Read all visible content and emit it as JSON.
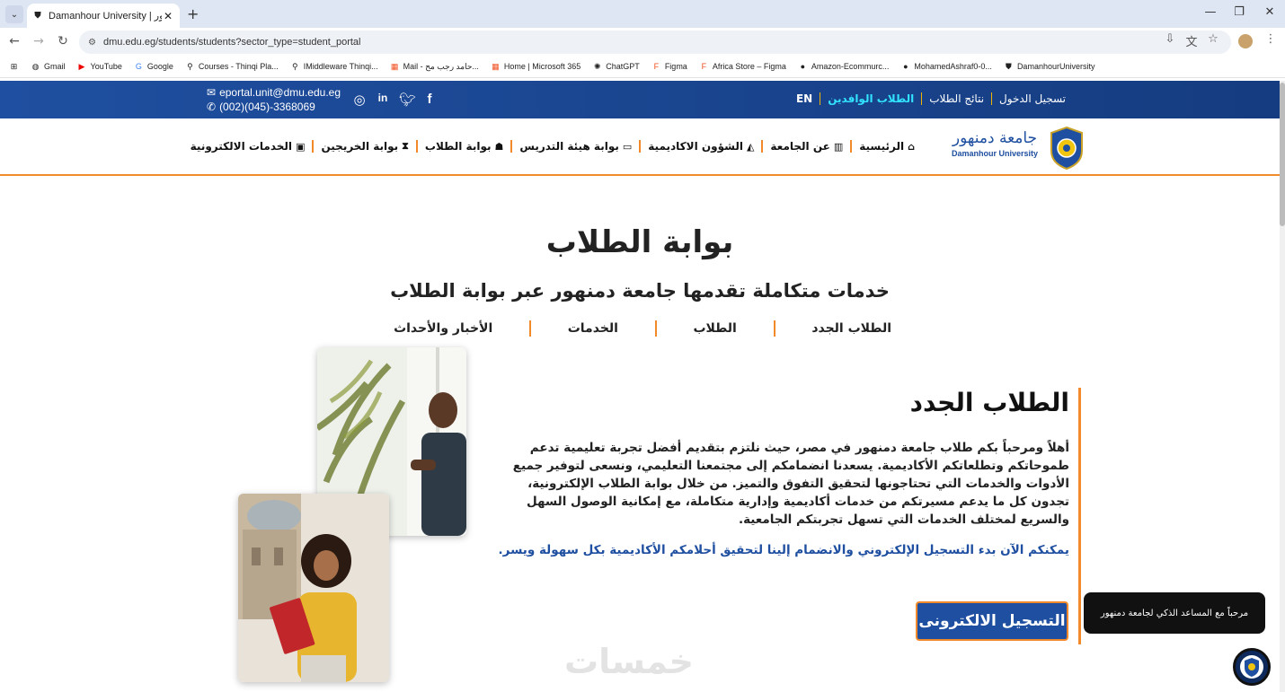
{
  "browser": {
    "tab_title": "Damanhour University | جامعة دمنهور",
    "url": "dmu.edu.eg/students/students?sector_type=student_portal",
    "bookmarks": [
      "Gmail",
      "YouTube",
      "Google",
      "Courses - Thinqi Pla...",
      "IMiddleware Thinqi...",
      "Mail - حامد رجب مح...",
      "Home | Microsoft 365",
      "ChatGPT",
      "Figma",
      "Africa Store – Figma",
      "Amazon-Ecommurc...",
      "MohamedAshraf0-0...",
      "DamanhourUniversity"
    ]
  },
  "topbar": {
    "email": "eportal.unit@dmu.edu.eg",
    "phone": "(002)(045)-3368069",
    "links": [
      "تسجيل الدخول",
      "نتائج الطلاب",
      "الطلاب الوافدين",
      "EN"
    ]
  },
  "logo": {
    "arabic": "جامعة دمنهور",
    "english": "Damanhour University"
  },
  "menu": [
    "الرئيسية",
    "عن الجامعة",
    "الشؤون الاكاديمية",
    "بوابة هيئة التدريس",
    "بوابة الطلاب",
    "بوابة الخريجين",
    "الخدمات الالكترونية"
  ],
  "hero": {
    "title": "بوابة الطلاب",
    "subtitle": "خدمات متكاملة تقدمها جامعة دمنهور عبر بوابة الطلاب",
    "tabs": [
      "الطلاب الجدد",
      "الطلاب",
      "الخدمات",
      "الأخبار والأحداث"
    ]
  },
  "section": {
    "heading": "الطلاب الجدد",
    "body": "أهلاً ومرحباً بكم طلاب جامعة دمنهور في مصر، حيث نلتزم بتقديم أفضل تجربة تعليمية تدعم طموحاتكم وتطلعاتكم الأكاديمية. يسعدنا انضمامكم إلى مجتمعنا التعليمي، ونسعى لتوفير جميع الأدوات والخدمات التي تحتاجونها لتحقيق التفوق والتميز. من خلال بوابة الطلاب الإلكترونية، تجدون كل ما يدعم مسيرتكم من خدمات أكاديمية وإدارية متكاملة، مع إمكانية الوصول السهل والسريع لمختلف الخدمات التي تسهل تجربتكم الجامعية.",
    "cta_text": "يمكنكم الآن بدء التسجيل الإلكتروني والانضمام إلينا لتحقيق أحلامكم الأكاديمية بكل سهولة ويسر.",
    "button": "التسجيل الالكترونى"
  },
  "watermark": "خمسات",
  "chat": {
    "bubble": "مرحباً مع المساعد الذكي لجامعة دمنهور"
  },
  "colors": {
    "brand_blue": "#1f4fa0",
    "accent_orange": "#f28a2c",
    "highlight_cyan": "#31e3ff"
  }
}
